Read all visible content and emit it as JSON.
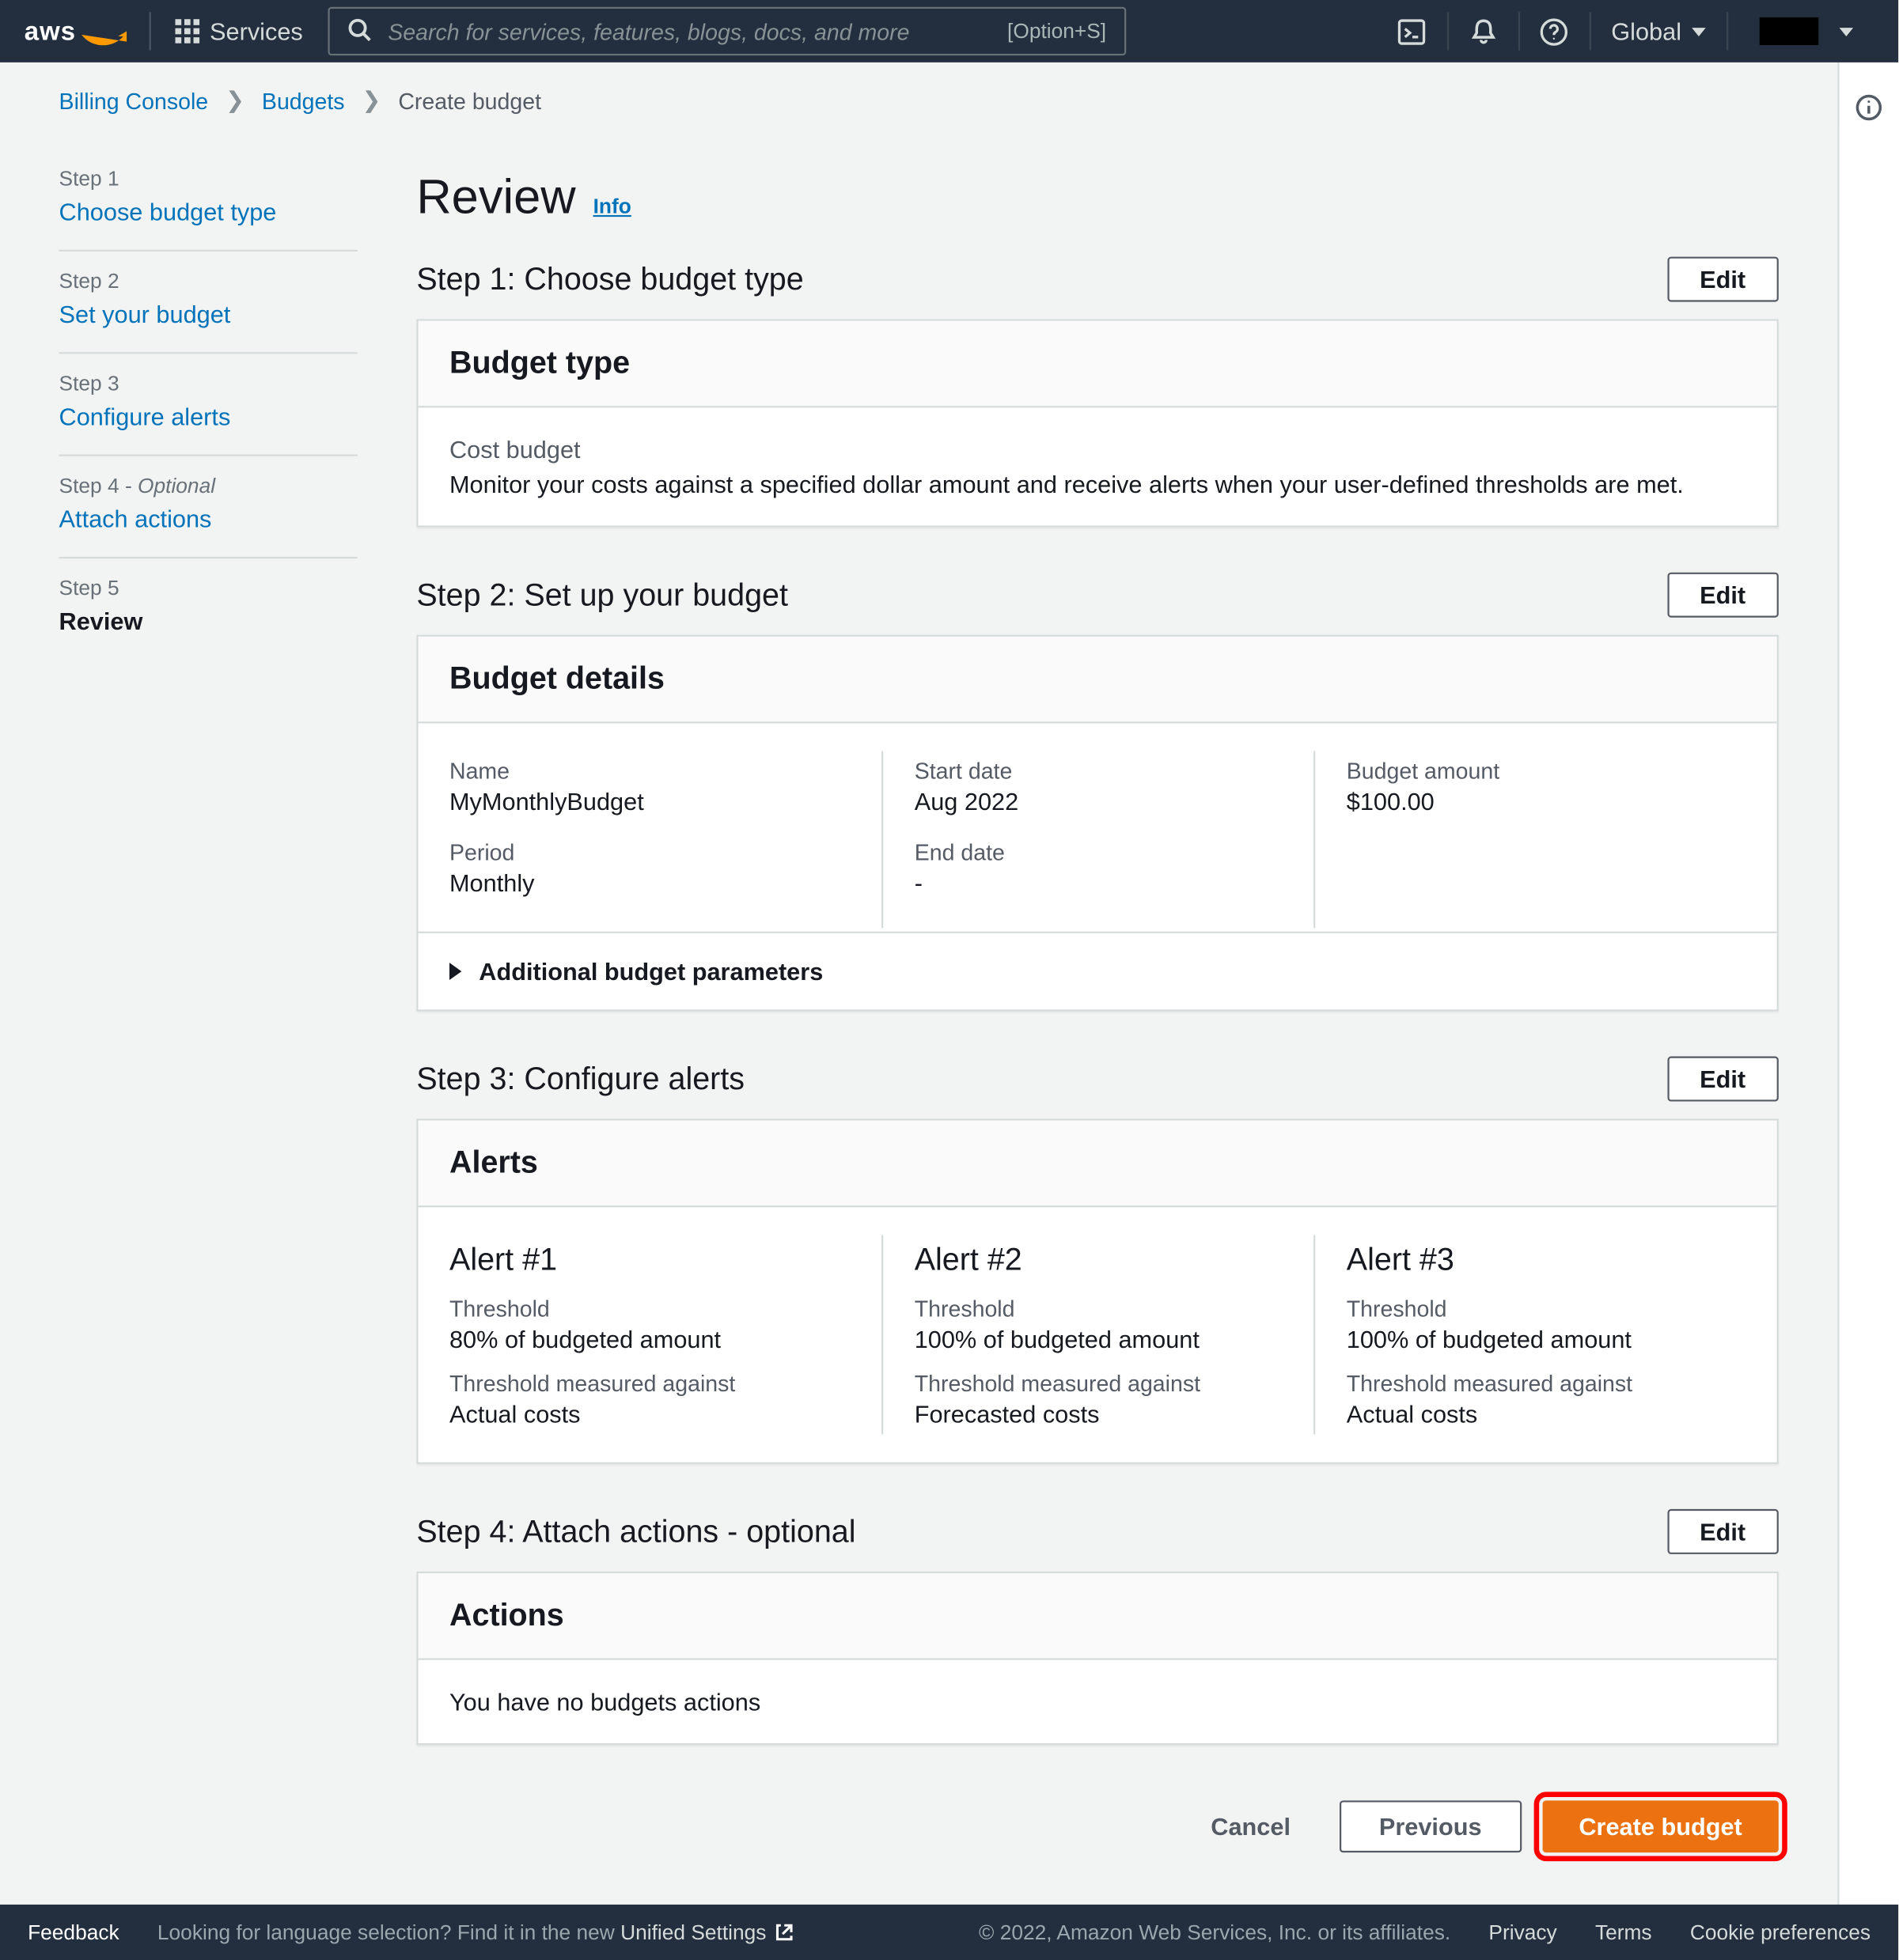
{
  "nav": {
    "services_label": "Services",
    "search_placeholder": "Search for services, features, blogs, docs, and more",
    "search_kbd": "[Option+S]",
    "region": "Global"
  },
  "breadcrumbs": {
    "a": "Billing Console",
    "b": "Budgets",
    "c": "Create budget"
  },
  "steps": [
    {
      "label": "Step 1",
      "name": "Choose budget type"
    },
    {
      "label": "Step 2",
      "name": "Set your budget"
    },
    {
      "label": "Step 3",
      "name": "Configure alerts"
    },
    {
      "label": "Step 4 - ",
      "opt": "Optional",
      "name": "Attach actions"
    },
    {
      "label": "Step 5",
      "name": "Review"
    }
  ],
  "page": {
    "title": "Review",
    "info": "Info"
  },
  "sec1": {
    "heading": "Step 1: Choose budget type",
    "edit": "Edit",
    "card_title": "Budget type",
    "type_name": "Cost budget",
    "type_desc": "Monitor your costs against a specified dollar amount and receive alerts when your user-defined thresholds are met."
  },
  "sec2": {
    "heading": "Step 2: Set up your budget",
    "edit": "Edit",
    "card_title": "Budget details",
    "labels": {
      "name": "Name",
      "start": "Start date",
      "amount": "Budget amount",
      "period": "Period",
      "end": "End date"
    },
    "values": {
      "name": "MyMonthlyBudget",
      "start": "Aug 2022",
      "amount": "$100.00",
      "period": "Monthly",
      "end": "-"
    },
    "expander": "Additional budget parameters"
  },
  "sec3": {
    "heading": "Step 3: Configure alerts",
    "edit": "Edit",
    "card_title": "Alerts",
    "labels": {
      "threshold": "Threshold",
      "measured": "Threshold measured against"
    },
    "alerts": [
      {
        "title": "Alert #1",
        "threshold": "80% of budgeted amount",
        "measured": "Actual costs"
      },
      {
        "title": "Alert #2",
        "threshold": "100% of budgeted amount",
        "measured": "Forecasted costs"
      },
      {
        "title": "Alert #3",
        "threshold": "100% of budgeted amount",
        "measured": "Actual costs"
      }
    ]
  },
  "sec4": {
    "heading": "Step 4: Attach actions - optional",
    "edit": "Edit",
    "card_title": "Actions",
    "body": "You have no budgets actions"
  },
  "actions": {
    "cancel": "Cancel",
    "previous": "Previous",
    "create": "Create budget"
  },
  "footer": {
    "feedback": "Feedback",
    "lang": "Looking for language selection? Find it in the new",
    "unified": "Unified Settings",
    "copy": "© 2022, Amazon Web Services, Inc. or its affiliates.",
    "privacy": "Privacy",
    "terms": "Terms",
    "cookie": "Cookie preferences"
  }
}
